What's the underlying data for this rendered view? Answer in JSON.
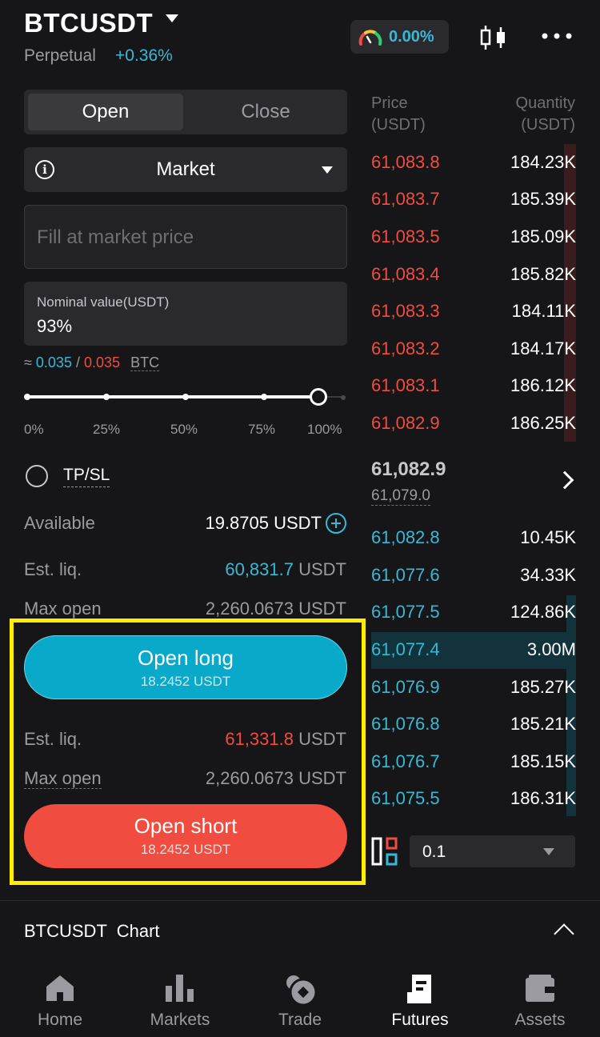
{
  "header": {
    "symbol": "BTCUSDT",
    "contract_type": "Perpetual",
    "change": "+0.36%",
    "sentiment": "0.00%"
  },
  "order_form": {
    "tabs": [
      {
        "label": "Open",
        "active": true
      },
      {
        "label": "Close",
        "active": false
      }
    ],
    "order_type": "Market",
    "price_placeholder": "Fill at market price",
    "nominal_label": "Nominal value(USDT)",
    "nominal_value": "93%",
    "approx_prefix": "≈",
    "approx_long": "0.035",
    "approx_sep": "/",
    "approx_short": "0.035",
    "approx_unit": "BTC",
    "slider_percent": 100,
    "slider_ticks": [
      "0%",
      "25%",
      "50%",
      "75%",
      "100%"
    ],
    "tpsl_label": "TP/SL",
    "available_label": "Available",
    "available_value": "19.8705 USDT",
    "long_liq_label": "Est. liq.",
    "long_liq_value": "60,831.7",
    "long_liq_unit": "USDT",
    "long_max_label": "Max open",
    "long_max_value": "2,260.0673 USDT",
    "open_long_label": "Open long",
    "open_long_sub": "18.2452 USDT",
    "short_liq_label": "Est. liq.",
    "short_liq_value": "61,331.8",
    "short_liq_unit": "USDT",
    "short_max_label": "Max open",
    "short_max_value": "2,260.0673 USDT",
    "open_short_label": "Open short",
    "open_short_sub": "18.2452 USDT"
  },
  "orderbook": {
    "price_header_1": "Price",
    "price_header_2": "(USDT)",
    "qty_header_1": "Quantity",
    "qty_header_2": "(USDT)",
    "asks": [
      {
        "price": "61,083.8",
        "qty": "184.23K"
      },
      {
        "price": "61,083.7",
        "qty": "185.39K"
      },
      {
        "price": "61,083.5",
        "qty": "185.09K"
      },
      {
        "price": "61,083.4",
        "qty": "185.82K"
      },
      {
        "price": "61,083.3",
        "qty": "184.11K"
      },
      {
        "price": "61,083.2",
        "qty": "184.17K"
      },
      {
        "price": "61,083.1",
        "qty": "186.12K"
      },
      {
        "price": "61,082.9",
        "qty": "186.25K"
      }
    ],
    "last_price": "61,082.9",
    "mark_price": "61,079.0",
    "bids": [
      {
        "price": "61,082.8",
        "qty": "10.45K"
      },
      {
        "price": "61,077.6",
        "qty": "34.33K"
      },
      {
        "price": "61,077.5",
        "qty": "124.86K"
      },
      {
        "price": "61,077.4",
        "qty": "3.00M"
      },
      {
        "price": "61,076.9",
        "qty": "185.27K"
      },
      {
        "price": "61,076.8",
        "qty": "185.21K"
      },
      {
        "price": "61,076.7",
        "qty": "185.15K"
      },
      {
        "price": "61,075.5",
        "qty": "186.31K"
      }
    ],
    "depth_step": "0.1"
  },
  "chart_bar": {
    "title": "BTCUSDT  Chart"
  },
  "nav": [
    {
      "label": "Home",
      "icon": "home-icon",
      "active": false
    },
    {
      "label": "Markets",
      "icon": "bar-chart-icon",
      "active": false
    },
    {
      "label": "Trade",
      "icon": "trade-icon",
      "active": false
    },
    {
      "label": "Futures",
      "icon": "futures-icon",
      "active": true
    },
    {
      "label": "Assets",
      "icon": "wallet-icon",
      "active": false
    }
  ],
  "colors": {
    "long": "#09aac9",
    "short": "#f04c3f",
    "highlight": "#ffee00"
  }
}
